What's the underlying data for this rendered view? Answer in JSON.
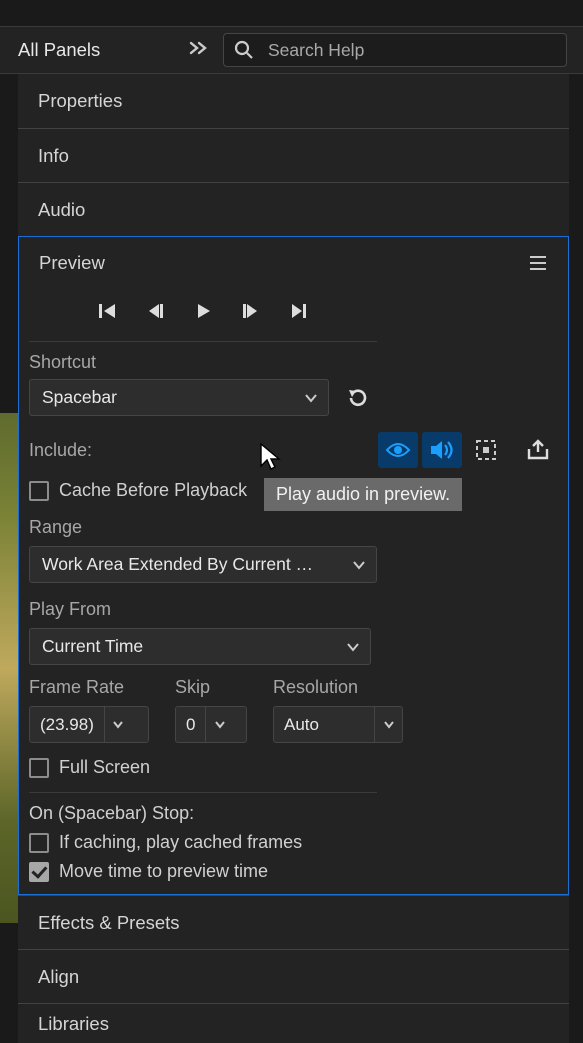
{
  "topbar": {
    "workspace": "All Panels",
    "search_placeholder": "Search Help"
  },
  "panels": {
    "properties": "Properties",
    "info": "Info",
    "audio": "Audio",
    "effects": "Effects & Presets",
    "align": "Align",
    "libraries": "Libraries"
  },
  "preview": {
    "title": "Preview",
    "shortcut_label": "Shortcut",
    "shortcut_value": "Spacebar",
    "include_label": "Include:",
    "cache_label": "Cache Before Playback",
    "cache_checked": false,
    "range_label": "Range",
    "range_value": "Work Area Extended By Current …",
    "playfrom_label": "Play From",
    "playfrom_value": "Current Time",
    "framerate_label": "Frame Rate",
    "framerate_value": "(23.98)",
    "skip_label": "Skip",
    "skip_value": "0",
    "resolution_label": "Resolution",
    "resolution_value": "Auto",
    "fullscreen_label": "Full Screen",
    "fullscreen_checked": false,
    "onstop_label": "On (Spacebar) Stop:",
    "ifcaching_label": "If caching, play cached frames",
    "ifcaching_checked": false,
    "movetime_label": "Move time to preview time",
    "movetime_checked": true,
    "tooltip": "Play audio in preview.",
    "include_video": true,
    "include_audio": true,
    "include_overlays": false
  }
}
